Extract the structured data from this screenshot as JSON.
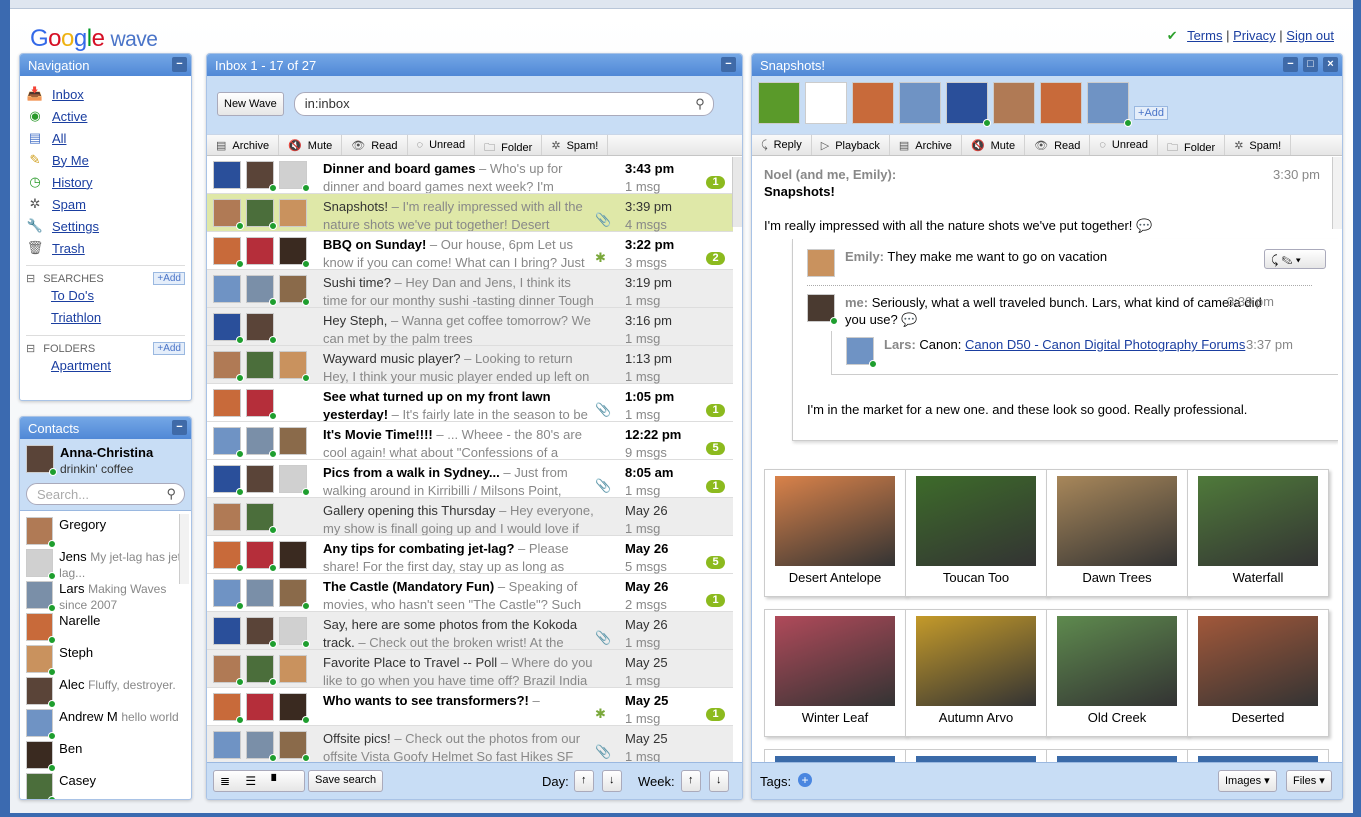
{
  "header": {
    "logo_text": "Google",
    "logo_suffix": "wave",
    "links": [
      "Terms",
      "Privacy",
      "Sign out"
    ]
  },
  "navigation": {
    "title": "Navigation",
    "items": [
      {
        "label": "Inbox",
        "icon": "inbox-icon"
      },
      {
        "label": "Active",
        "icon": "active-icon"
      },
      {
        "label": "All",
        "icon": "all-icon"
      },
      {
        "label": "By Me",
        "icon": "pencil-icon"
      },
      {
        "label": "History",
        "icon": "clock-icon"
      },
      {
        "label": "Spam",
        "icon": "spam-icon"
      },
      {
        "label": "Settings",
        "icon": "wrench-icon"
      },
      {
        "label": "Trash",
        "icon": "trash-icon"
      }
    ],
    "searches_label": "SEARCHES",
    "add_label": "Add",
    "searches": [
      "To Do's",
      "Triathlon"
    ],
    "folders_label": "FOLDERS",
    "folders": [
      "Apartment"
    ]
  },
  "contacts": {
    "title": "Contacts",
    "me": {
      "name": "Anna-Christina",
      "status": "drinkin' coffee"
    },
    "search_placeholder": "Search...",
    "list": [
      {
        "name": "Gregory",
        "status": ""
      },
      {
        "name": "Jens",
        "status": "My jet-lag has jet-lag..."
      },
      {
        "name": "Lars",
        "status": "Making Waves since 2007"
      },
      {
        "name": "Narelle",
        "status": ""
      },
      {
        "name": "Steph",
        "status": ""
      },
      {
        "name": "Alec",
        "status": "Fluffy, destroyer."
      },
      {
        "name": "Andrew M",
        "status": "hello world"
      },
      {
        "name": "Ben",
        "status": ""
      },
      {
        "name": "Casey",
        "status": ""
      }
    ]
  },
  "inbox": {
    "title": "Inbox 1 - 17 of 27",
    "new_wave": "New Wave",
    "search_value": "in:inbox",
    "toolbar": [
      "Archive",
      "Mute",
      "Read",
      "Unread",
      "Folder",
      "Spam!"
    ],
    "rows": [
      {
        "title": "Dinner and board games",
        "snippet": "Who's up for dinner and board games next week? I'm thinking",
        "time": "3:43 pm",
        "count": "1 msg",
        "badge": "1",
        "unread": true,
        "icon": "",
        "avatars": 3
      },
      {
        "title": "Snapshots!",
        "snippet": "I'm really impressed with all the nature shots we've put together! Desert",
        "time": "3:39 pm",
        "count": "4 msgs",
        "badge": "",
        "unread": false,
        "selected": true,
        "icon": "paperclip-icon",
        "avatars": 3
      },
      {
        "title": "BBQ on Sunday!",
        "snippet": "Our house, 6pm Let us know if you can come! What can I bring? Just",
        "time": "3:22 pm",
        "count": "3 msgs",
        "badge": "2",
        "unread": true,
        "icon": "puzzle-icon",
        "avatars": 3
      },
      {
        "title": "Sushi time?",
        "snippet": "Hey Dan and Jens, I think its time for our monthy sushi -tasting dinner Tough",
        "time": "3:19 pm",
        "count": "1 msg",
        "badge": "",
        "unread": false,
        "icon": "",
        "avatars": 3
      },
      {
        "title": "Hey Steph,",
        "snippet": "Wanna get coffee tomorrow? We can met by the palm trees",
        "time": "3:16 pm",
        "count": "1 msg",
        "badge": "",
        "unread": false,
        "icon": "",
        "avatars": 2
      },
      {
        "title": "Wayward music player?",
        "snippet": "Looking to return Hey, I think your music player ended up left on my desk",
        "time": "1:13 pm",
        "count": "1 msg",
        "badge": "",
        "unread": false,
        "icon": "",
        "avatars": 3
      },
      {
        "title": "See what turned up on my front lawn yesterday!",
        "snippet": "It's fairly late in the season to be",
        "time": "1:05 pm",
        "count": "1 msg",
        "badge": "1",
        "unread": true,
        "icon": "paperclip-icon",
        "avatars": 2
      },
      {
        "title": "It's Movie Time!!!!",
        "snippet": "... Wheee - the 80's are cool again! what about \"Confessions of a Shopaholic\"?",
        "time": "12:22 pm",
        "count": "9 msgs",
        "badge": "5",
        "unread": true,
        "icon": "",
        "avatars": 3
      },
      {
        "title": "Pics from a walk in Sydney...",
        "snippet": "Just from walking around in Kirribilli / Milsons Point,",
        "time": "8:05 am",
        "count": "1 msg",
        "badge": "1",
        "unread": true,
        "icon": "paperclip-icon",
        "avatars": 3
      },
      {
        "title": "Gallery opening this Thursday",
        "snippet": "Hey everyone, my show is finall going up and I would love if your",
        "time": "May 26",
        "count": "1 msg",
        "badge": "",
        "unread": false,
        "icon": "",
        "avatars": 2
      },
      {
        "title": "Any tips for combating jet-lag?",
        "snippet": "Please share! For the first day, stay up as long as possible. Get",
        "time": "May 26",
        "count": "5 msgs",
        "badge": "5",
        "unread": true,
        "icon": "",
        "avatars": 3
      },
      {
        "title": "The Castle (Mandatory Fun)",
        "snippet": "Speaking of movies, who hasn't seen \"The Castle\"? Such",
        "time": "May 26",
        "count": "2 msgs",
        "badge": "1",
        "unread": true,
        "icon": "",
        "avatars": 3
      },
      {
        "title": "Say, here are some photos from the Kokoda track.",
        "snippet": "Check out the broken wrist! At the",
        "time": "May 26",
        "count": "1 msg",
        "badge": "",
        "unread": false,
        "icon": "paperclip-icon",
        "avatars": 3
      },
      {
        "title": "Favorite Place to Travel -- Poll",
        "snippet": "Where do you like to go when you have time off? Brazil India",
        "time": "May 25",
        "count": "1 msg",
        "badge": "",
        "unread": false,
        "icon": "",
        "avatars": 3
      },
      {
        "title": "Who wants to see transformers?!",
        "snippet": "",
        "time": "May 25",
        "count": "1 msg",
        "badge": "1",
        "unread": true,
        "icon": "puzzle-icon",
        "avatars": 3
      },
      {
        "title": "Offsite pics!",
        "snippet": "Check out the photos from our offsite Vista Goofy Helmet So fast Hikes SF",
        "time": "May 25",
        "count": "1 msg",
        "badge": "",
        "unread": false,
        "icon": "paperclip-icon",
        "avatars": 3
      }
    ],
    "footer": {
      "save_search": "Save search",
      "day_label": "Day:",
      "week_label": "Week:"
    }
  },
  "wave": {
    "title": "Snapshots!",
    "add_label": "Add",
    "participants": 8,
    "toolbar": [
      "Reply",
      "Playback",
      "Archive",
      "Mute",
      "Read",
      "Unread",
      "Folder",
      "Spam!"
    ],
    "root": {
      "authors": "Noel (and me, Emily):",
      "time": "3:30 pm",
      "subject": "Snapshots!",
      "body": "I'm really impressed with all the nature shots we've put together!"
    },
    "replies": [
      {
        "author": "Emily:",
        "text": "They make me want to go on vacation",
        "time": ""
      },
      {
        "author": "me:",
        "text": "Seriously, what a well traveled bunch. Lars, what kind of camera did you use?",
        "time": "3:39 pm"
      },
      {
        "author": "Lars:",
        "text": "Canon:",
        "link": "Canon D50 - Canon Digital Photography Forums",
        "time": "3:37 pm"
      }
    ],
    "continuation": "I'm in the market for a new one. and these look so good. Really professional.",
    "photos": [
      {
        "caption": "Desert Antelope",
        "color": "#d9824a"
      },
      {
        "caption": "Toucan Too",
        "color": "#3d6b2a"
      },
      {
        "caption": "Dawn Trees",
        "color": "#a8875a"
      },
      {
        "caption": "Waterfall",
        "color": "#4f7a3a"
      },
      {
        "caption": "Winter Leaf",
        "color": "#b04a5a"
      },
      {
        "caption": "Autumn Arvo",
        "color": "#c49a2a"
      },
      {
        "caption": "Old Creek",
        "color": "#5e8a4e"
      },
      {
        "caption": "Deserted",
        "color": "#a2583a"
      }
    ],
    "footer": {
      "tags_label": "Tags:",
      "images": "Images",
      "files": "Files"
    }
  },
  "colors": {
    "header_blue": "#5088d6",
    "light_blue": "#c8ddf5",
    "selected_row": "#dfe8a8",
    "badge_green": "#8cba1e",
    "link": "#1a3ea0"
  }
}
